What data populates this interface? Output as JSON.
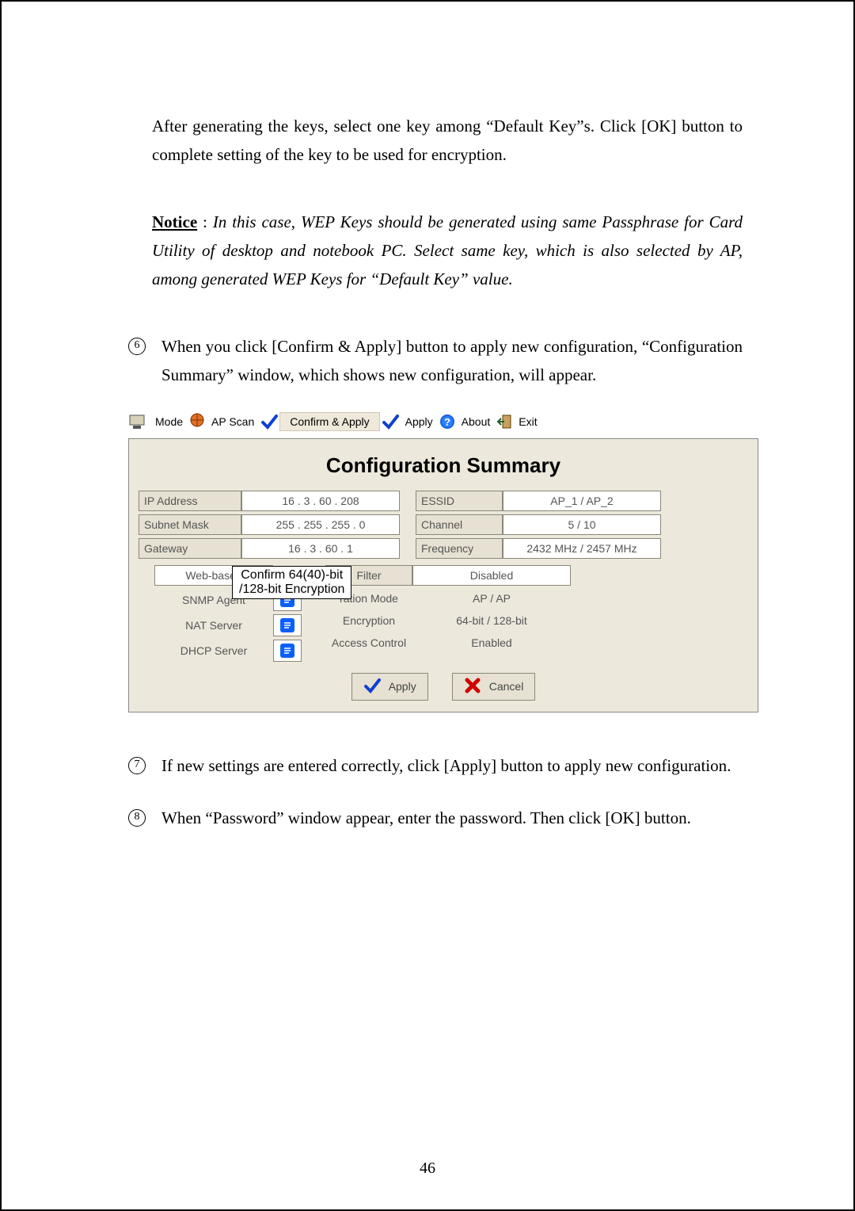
{
  "para1_pre": "After generating the keys, select one key among ",
  "para1_q1": "“Default Key”",
  "para1_mid": "s. Click [OK] button to complete setting of the key to be used for encryption.",
  "notice_label": "Notice",
  "notice_colon": " : ",
  "notice_text": "In this case, WEP Keys should be generated using same Passphrase for Card Utility of desktop and notebook PC. Select same key, which is also selected by AP, among generated WEP Keys for “Default Key” value.",
  "step6_num": "6",
  "step6_text": "When you click [Confirm & Apply] button to apply new configuration, “Configuration Summary” window, which shows new configuration, will appear.",
  "step7_num": "7",
  "step7_text": "If new settings are entered correctly, click [Apply] button to apply new configuration.",
  "step8_num": "8",
  "step8_text": "When “Password” window appear, enter the password. Then click [OK] button.",
  "page_number": "46",
  "toolbar": {
    "mode": "Mode",
    "ap_scan": "AP Scan",
    "confirm_apply": "Confirm & Apply",
    "apply": "Apply",
    "about": "About",
    "exit": "Exit"
  },
  "summary": {
    "title": "Configuration Summary",
    "left": {
      "ip_label": "IP Address",
      "ip_val": "16 .  3  . 60 . 208",
      "mask_label": "Subnet Mask",
      "mask_val": "255 . 255 . 255 .  0",
      "gw_label": "Gateway",
      "gw_val": "16 .  3  . 60 .  1"
    },
    "right": {
      "essid_label": "ESSID",
      "essid_val": "AP_1 / AP_2",
      "chan_label": "Channel",
      "chan_val": "5 / 10",
      "freq_label": "Frequency",
      "freq_val": "2432 MHz / 2457 MHz"
    },
    "callout": "Confirm 64(40)-bit\n/128-bit Encryption",
    "servers": {
      "web": "Web-based",
      "snmp": "SNMP Agent",
      "nat": "NAT Server",
      "dhcp": "DHCP Server"
    },
    "props": {
      "filter_label": "Filter",
      "filter_val": "Disabled",
      "opmode_label": "ration Mode",
      "opmode_val": "AP / AP",
      "enc_label": "Encryption",
      "enc_val": "64-bit / 128-bit",
      "acc_label": "Access Control",
      "acc_val": "Enabled"
    },
    "apply_btn": "Apply",
    "cancel_btn": "Cancel"
  }
}
